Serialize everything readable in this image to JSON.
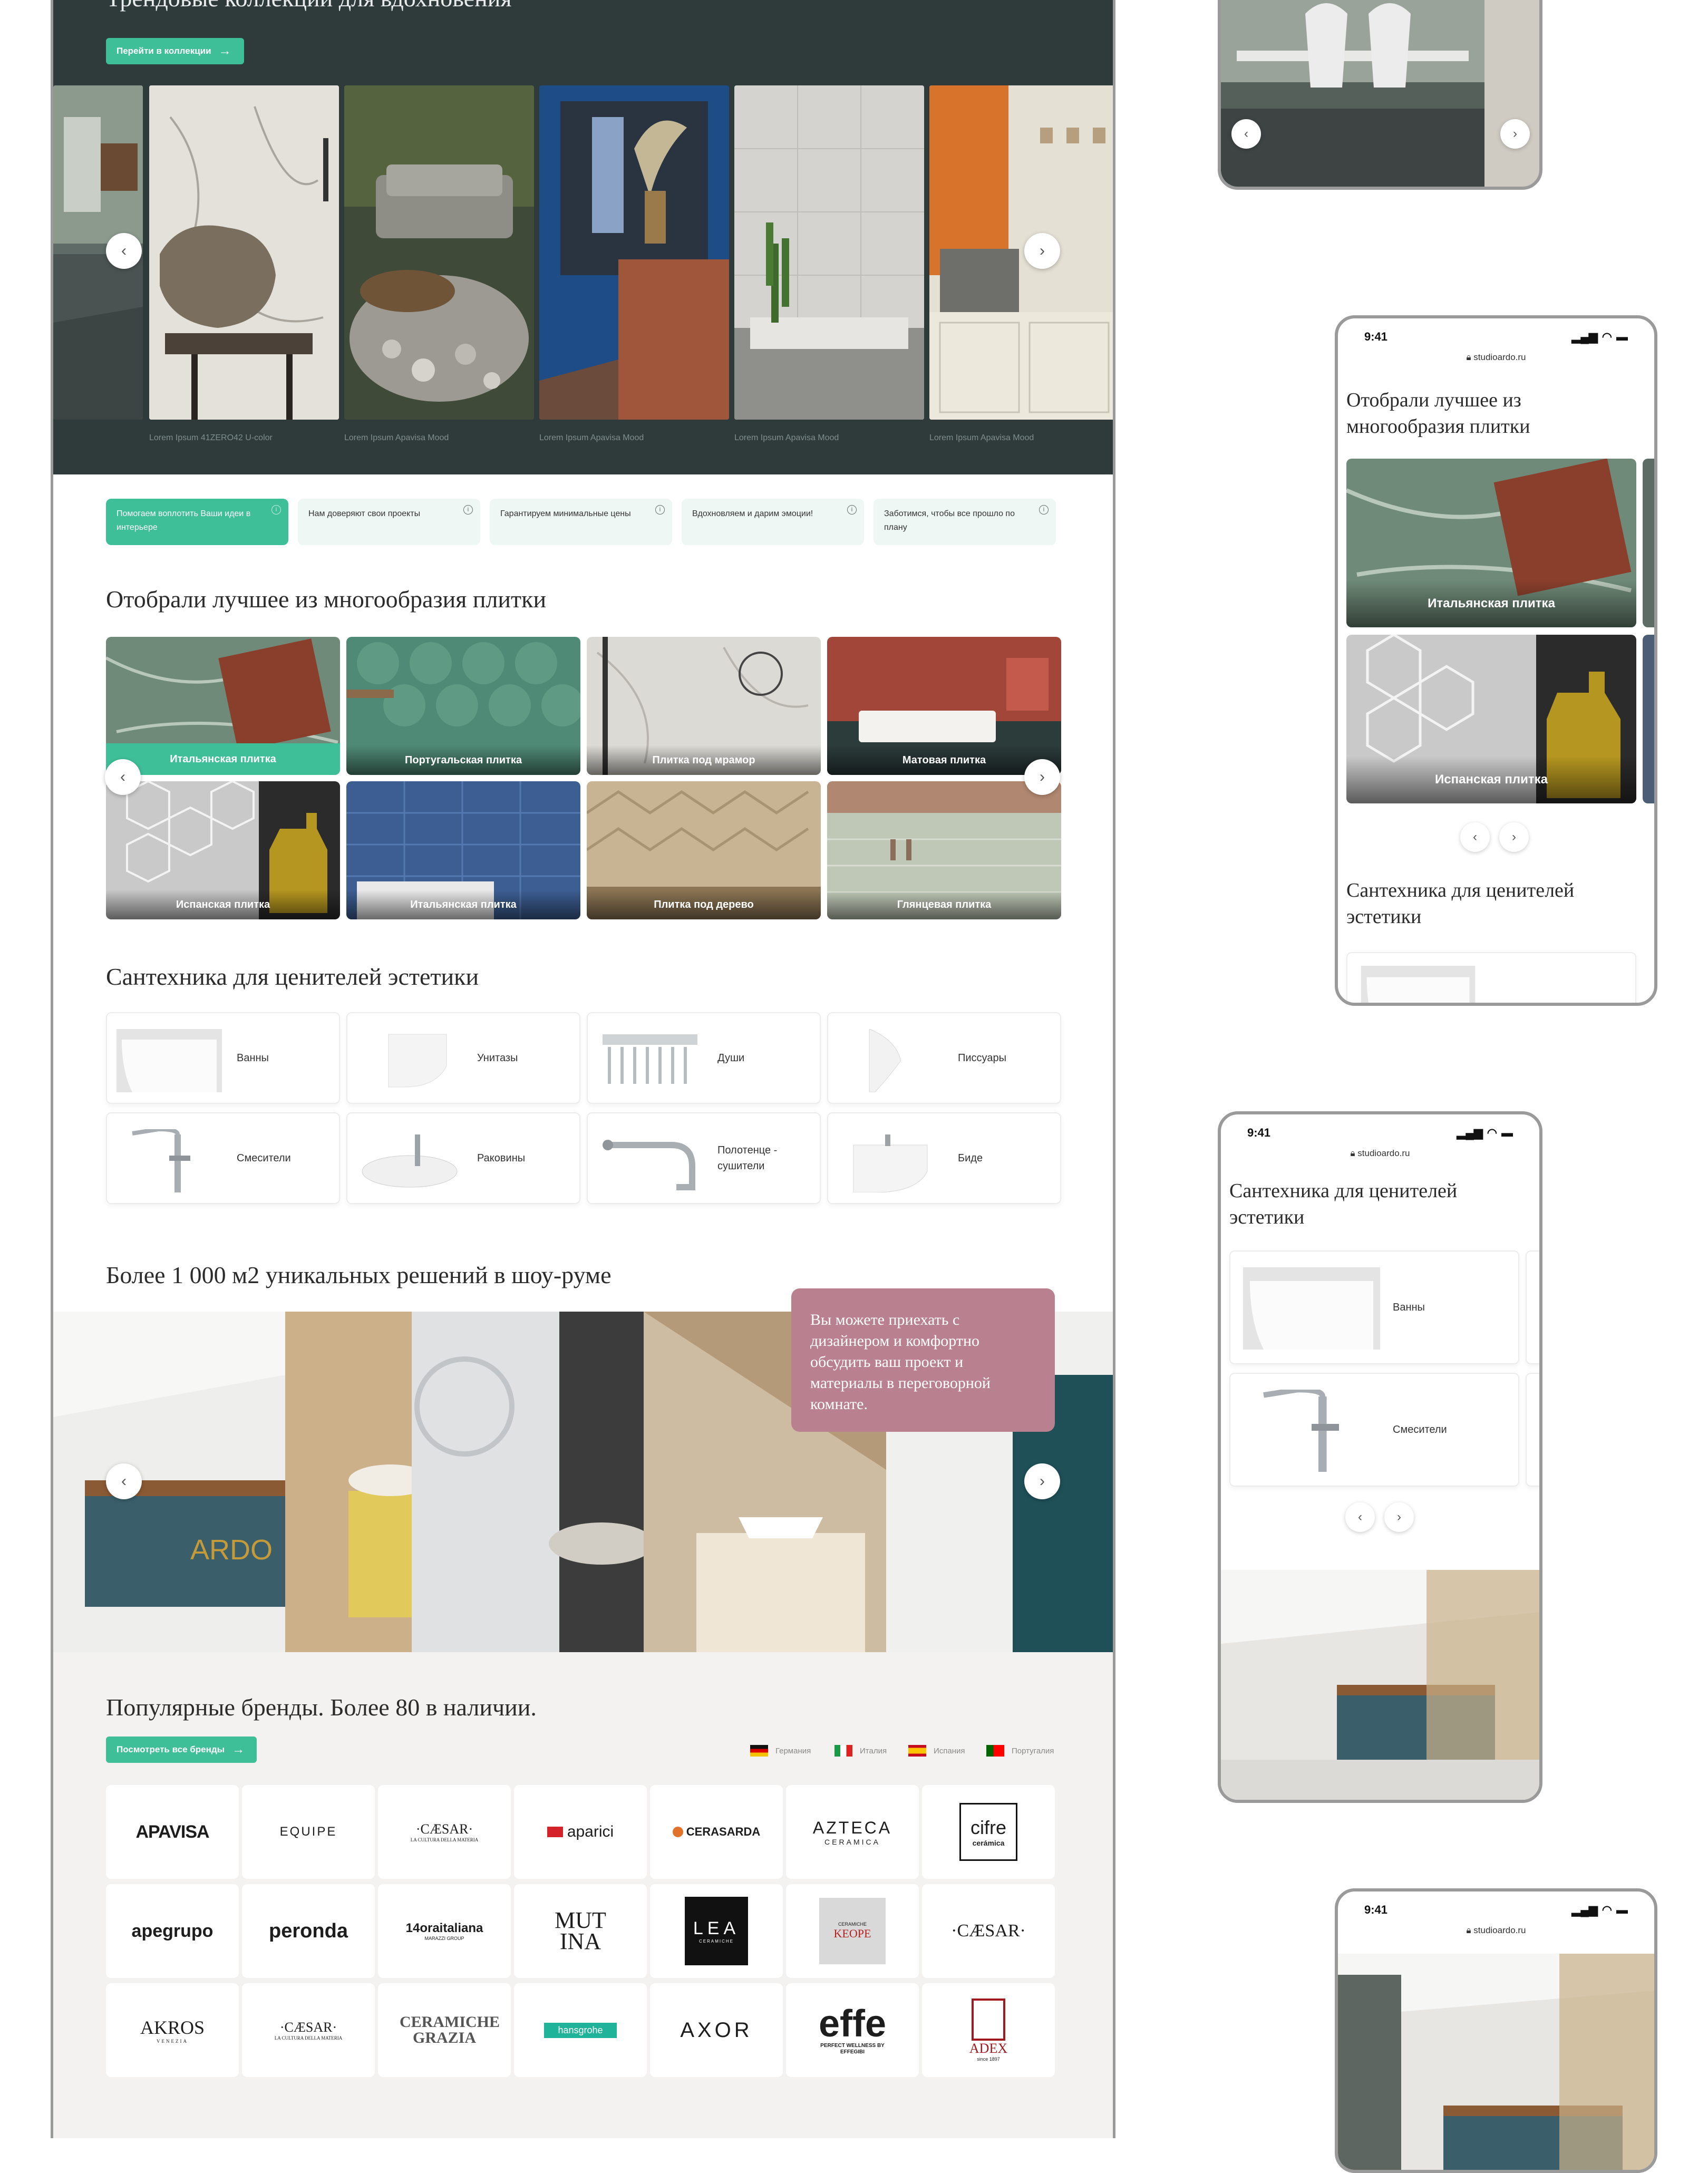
{
  "hero": {
    "title": "Трендовые коллекции для вдохновения",
    "button_label": "Перейти в коллекции",
    "captions": [
      "Lorem Ipsum 41ZERO42 U-color",
      "Lorem Ipsum Apavisa Mood",
      "Lorem Ipsum  Apavisa Mood",
      "Lorem Ipsum  Apavisa Mood",
      "Lorem Ipsum  Apavisa Mood"
    ]
  },
  "features": [
    {
      "label": "Помогаем воплотить Ваши идеи в интерьере",
      "active": true
    },
    {
      "label": "Нам доверяют свои проекты",
      "active": false
    },
    {
      "label": "Гарантируем минимальные цены",
      "active": false
    },
    {
      "label": "Вдохновляем и дарим эмоции!",
      "active": false
    },
    {
      "label": "Заботимся, чтобы все прошло по плану",
      "active": false
    }
  ],
  "tiles": {
    "title": "Отобрали лучшее из многообразия плитки",
    "items": [
      "Итальянская плитка",
      "Португальская плитка",
      "Плитка под мрамор",
      "Матовая плитка",
      "Испанская плитка",
      "Итальянская плитка",
      "Плитка под дерево",
      "Глянцевая плитка"
    ]
  },
  "plumbing": {
    "title": "Сантехника для ценителей эстетики",
    "items": [
      "Ванны",
      "Унитазы",
      "Души",
      "Писсуары",
      "Смесители",
      "Раковины",
      "Полотенце - сушители",
      "Биде"
    ]
  },
  "showroom": {
    "title": "Более 1 000 м2 уникальных решений в шоу-руме",
    "card_text": "Вы можете приехать с дизайнером и комфортно обсудить ваш проект и материалы в переговорной комнате.",
    "reception_sign": "ARDO"
  },
  "brands": {
    "title": "Популярные бренды. Более 80 в наличии.",
    "button_label": "Посмотреть все бренды",
    "countries": [
      "Германия",
      "Италия",
      "Испания",
      "Португалия"
    ],
    "logos": [
      "APAVISA",
      "EQUIPE",
      "·CÆSAR·",
      "aparici",
      "CERASARDA",
      "AZTECA",
      "cifre",
      "apegrupo",
      "peronda",
      "14oraitaliana",
      "MUTINA",
      "LEA",
      "KEOPE",
      "·CÆSAR·",
      "AKROS",
      "·CÆSAR·",
      "CERAMICHE GRAZIA",
      "hansgrohe",
      "AXOR",
      "effe",
      "ADEX"
    ],
    "logo_sublines": {
      "caesar": "LA CULTURA DELLA MATERIA",
      "azteca": "CERAMICA",
      "cifre": "cerámica",
      "oraitaliana": "MARAZZI GROUP",
      "lea": "CERAMICHE",
      "keope": "CERAMICHE",
      "akros": "VENEZIA",
      "effe": "PERFECT WELLNESS BY EFFEGIBI",
      "adex": "since 1897"
    }
  },
  "phones": {
    "time": "9:41",
    "url": "studioardo.ru",
    "tiles_title": "Отобрали лучшее из многообразия плитки",
    "tile_labels": [
      "Итальянская плитка",
      "Испанская плитка"
    ],
    "plumbing_title": "Сантехника для ценителей эстетики",
    "plumbing_items": [
      "Ванны",
      "Смесители"
    ]
  },
  "colors": {
    "accent": "#3fbf97",
    "hero_bg": "#2f3a3b",
    "card_pink": "#b9808f",
    "brands_bg": "#f3f2f0"
  }
}
